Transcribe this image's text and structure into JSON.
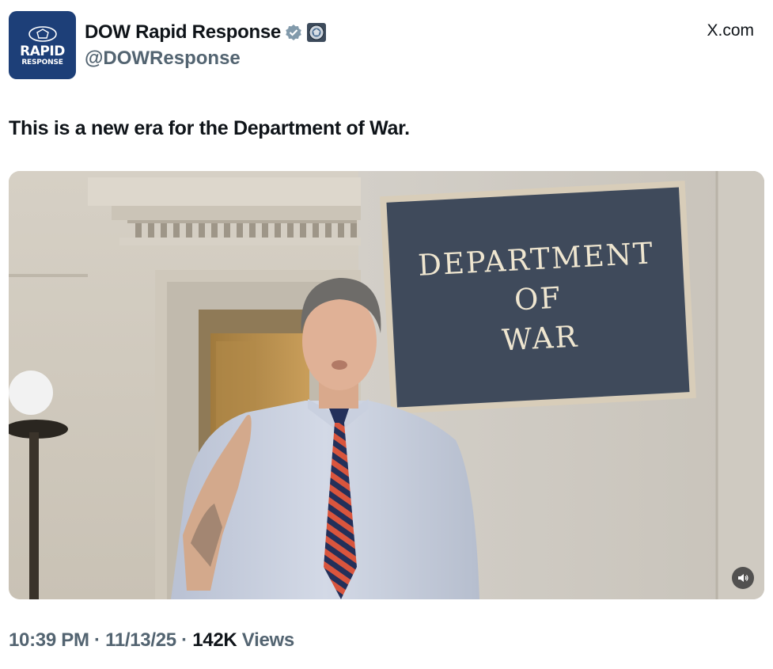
{
  "account": {
    "avatar_line1": "RAPID",
    "avatar_line2": "RESPONSE",
    "display_name": "DOW Rapid Response",
    "handle": "@DOWResponse",
    "verified_icon": "verified-badge-icon",
    "affiliate_icon": "affiliate-seal-icon"
  },
  "source_label": "X.com",
  "tweet": {
    "text": "This is a new era for the Department of War."
  },
  "media": {
    "sign_line1": "DEPARTMENT",
    "sign_line2": "OF",
    "sign_line3": "WAR",
    "mute_icon": "speaker-muted-icon"
  },
  "meta": {
    "time": "10:39 PM",
    "sep1": " · ",
    "date": "11/13/25",
    "sep2": " · ",
    "views_count": "142K",
    "views_label": "Views"
  },
  "colors": {
    "primary_text": "#0f1419",
    "secondary_text": "#536471",
    "avatar_bg": "#1d3f78",
    "sign_bg": "#3f4a5b",
    "sign_text": "#efe6d0"
  }
}
